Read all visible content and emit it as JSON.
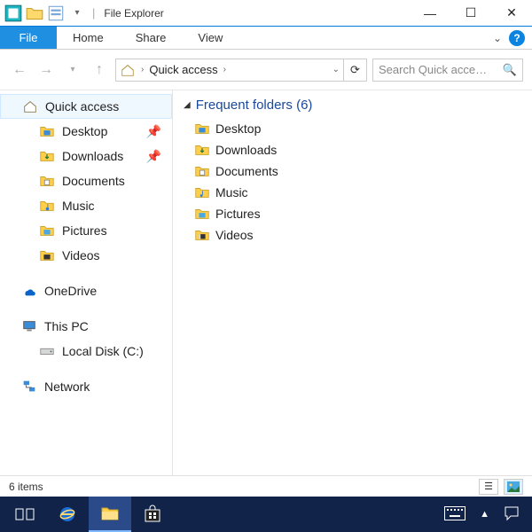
{
  "titlebar": {
    "title": "File Explorer"
  },
  "ribbon": {
    "file": "File",
    "tabs": [
      "Home",
      "Share",
      "View"
    ]
  },
  "nav": {
    "location": "Quick access",
    "search_placeholder": "Search Quick acce…"
  },
  "sidebar": {
    "quick_access": "Quick access",
    "items": [
      {
        "label": "Desktop",
        "pinned": true
      },
      {
        "label": "Downloads",
        "pinned": true
      },
      {
        "label": "Documents"
      },
      {
        "label": "Music"
      },
      {
        "label": "Pictures"
      },
      {
        "label": "Videos"
      }
    ],
    "onedrive": "OneDrive",
    "thispc": "This PC",
    "localdisk": "Local Disk (C:)",
    "network": "Network"
  },
  "main": {
    "group_label": "Frequent folders (6)",
    "folders": [
      "Desktop",
      "Downloads",
      "Documents",
      "Music",
      "Pictures",
      "Videos"
    ]
  },
  "status": {
    "text": "6 items"
  }
}
